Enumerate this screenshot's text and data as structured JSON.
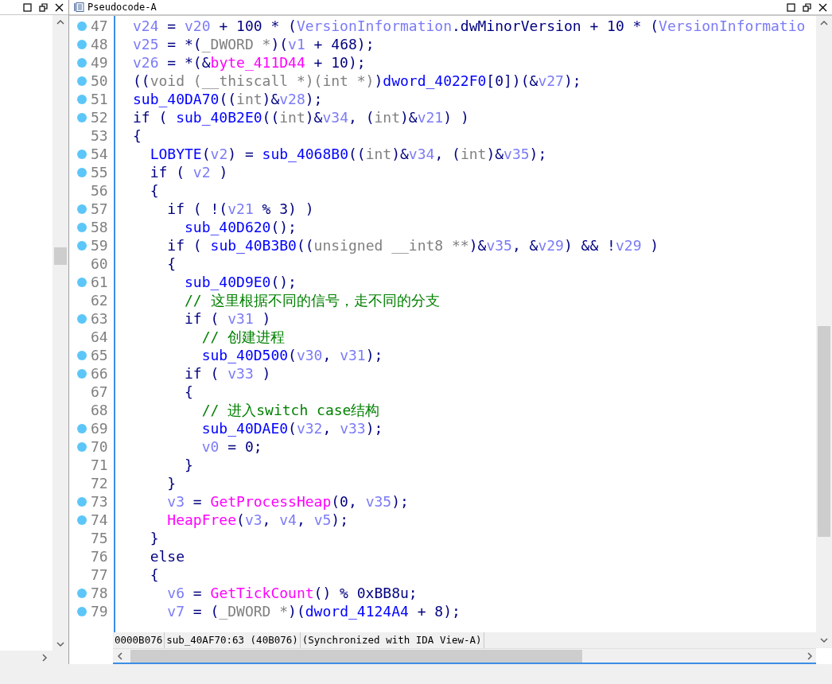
{
  "tab": {
    "title": "Pseudocode-A"
  },
  "code_lines": [
    {
      "number": "47",
      "dot": true,
      "tokens": [
        {
          "kind": "var",
          "text": "v24"
        },
        {
          "kind": "plain",
          "text": " = "
        },
        {
          "kind": "var",
          "text": "v20"
        },
        {
          "kind": "plain",
          "text": " + 100 * ("
        },
        {
          "kind": "var",
          "text": "VersionInformation"
        },
        {
          "kind": "plain",
          "text": ".dwMinorVersion + 10 * ("
        },
        {
          "kind": "var",
          "text": "VersionInformatio"
        }
      ]
    },
    {
      "number": "48",
      "dot": true,
      "tokens": [
        {
          "kind": "var",
          "text": "v25"
        },
        {
          "kind": "plain",
          "text": " = *("
        },
        {
          "kind": "type",
          "text": "_DWORD *"
        },
        {
          "kind": "plain",
          "text": ")("
        },
        {
          "kind": "var",
          "text": "v1"
        },
        {
          "kind": "plain",
          "text": " + 468);"
        }
      ]
    },
    {
      "number": "49",
      "dot": true,
      "tokens": [
        {
          "kind": "var",
          "text": "v26"
        },
        {
          "kind": "plain",
          "text": " = *(&"
        },
        {
          "kind": "import",
          "text": "byte_411D44"
        },
        {
          "kind": "plain",
          "text": " + 10);"
        }
      ]
    },
    {
      "number": "50",
      "dot": true,
      "tokens": [
        {
          "kind": "plain",
          "text": "(("
        },
        {
          "kind": "type",
          "text": "void (__thiscall *)(int *)"
        },
        {
          "kind": "plain",
          "text": ")"
        },
        {
          "kind": "func",
          "text": "dword_4022F0"
        },
        {
          "kind": "plain",
          "text": "[0])(&"
        },
        {
          "kind": "var",
          "text": "v27"
        },
        {
          "kind": "plain",
          "text": ");"
        }
      ]
    },
    {
      "number": "51",
      "dot": true,
      "tokens": [
        {
          "kind": "func",
          "text": "sub_40DA70"
        },
        {
          "kind": "plain",
          "text": "(("
        },
        {
          "kind": "type",
          "text": "int"
        },
        {
          "kind": "plain",
          "text": ")&"
        },
        {
          "kind": "var",
          "text": "v28"
        },
        {
          "kind": "plain",
          "text": ");"
        }
      ]
    },
    {
      "number": "52",
      "dot": true,
      "tokens": [
        {
          "kind": "plain",
          "text": "if ( "
        },
        {
          "kind": "func",
          "text": "sub_40B2E0"
        },
        {
          "kind": "plain",
          "text": "(("
        },
        {
          "kind": "type",
          "text": "int"
        },
        {
          "kind": "plain",
          "text": ")&"
        },
        {
          "kind": "var",
          "text": "v34"
        },
        {
          "kind": "plain",
          "text": ", ("
        },
        {
          "kind": "type",
          "text": "int"
        },
        {
          "kind": "plain",
          "text": ")&"
        },
        {
          "kind": "var",
          "text": "v21"
        },
        {
          "kind": "plain",
          "text": ") )"
        }
      ]
    },
    {
      "number": "53",
      "dot": false,
      "tokens": [
        {
          "kind": "plain",
          "text": "{"
        }
      ]
    },
    {
      "number": "54",
      "dot": true,
      "tokens": [
        {
          "kind": "func",
          "text": "  LOBYTE"
        },
        {
          "kind": "plain",
          "text": "("
        },
        {
          "kind": "var",
          "text": "v2"
        },
        {
          "kind": "plain",
          "text": ") = "
        },
        {
          "kind": "func",
          "text": "sub_4068B0"
        },
        {
          "kind": "plain",
          "text": "(("
        },
        {
          "kind": "type",
          "text": "int"
        },
        {
          "kind": "plain",
          "text": ")&"
        },
        {
          "kind": "var",
          "text": "v34"
        },
        {
          "kind": "plain",
          "text": ", ("
        },
        {
          "kind": "type",
          "text": "int"
        },
        {
          "kind": "plain",
          "text": ")&"
        },
        {
          "kind": "var",
          "text": "v35"
        },
        {
          "kind": "plain",
          "text": ");"
        }
      ]
    },
    {
      "number": "55",
      "dot": true,
      "tokens": [
        {
          "kind": "plain",
          "text": "  if ( "
        },
        {
          "kind": "var",
          "text": "v2"
        },
        {
          "kind": "plain",
          "text": " )"
        }
      ]
    },
    {
      "number": "56",
      "dot": false,
      "tokens": [
        {
          "kind": "plain",
          "text": "  {"
        }
      ]
    },
    {
      "number": "57",
      "dot": true,
      "tokens": [
        {
          "kind": "plain",
          "text": "    if ( !("
        },
        {
          "kind": "var",
          "text": "v21"
        },
        {
          "kind": "plain",
          "text": " % 3) )"
        }
      ]
    },
    {
      "number": "58",
      "dot": true,
      "tokens": [
        {
          "kind": "func",
          "text": "      sub_40D620"
        },
        {
          "kind": "plain",
          "text": "();"
        }
      ]
    },
    {
      "number": "59",
      "dot": true,
      "tokens": [
        {
          "kind": "plain",
          "text": "    if ( "
        },
        {
          "kind": "func",
          "text": "sub_40B3B0"
        },
        {
          "kind": "plain",
          "text": "(("
        },
        {
          "kind": "type",
          "text": "unsigned __int8 **"
        },
        {
          "kind": "plain",
          "text": ")&"
        },
        {
          "kind": "var",
          "text": "v35"
        },
        {
          "kind": "plain",
          "text": ", &"
        },
        {
          "kind": "var",
          "text": "v29"
        },
        {
          "kind": "plain",
          "text": ") && !"
        },
        {
          "kind": "var",
          "text": "v29"
        },
        {
          "kind": "plain",
          "text": " )"
        }
      ]
    },
    {
      "number": "60",
      "dot": false,
      "tokens": [
        {
          "kind": "plain",
          "text": "    {"
        }
      ]
    },
    {
      "number": "61",
      "dot": true,
      "tokens": [
        {
          "kind": "func",
          "text": "      sub_40D9E0"
        },
        {
          "kind": "plain",
          "text": "();"
        }
      ]
    },
    {
      "number": "62",
      "dot": false,
      "tokens": [
        {
          "kind": "comment",
          "text": "      // 这里根据不同的信号，走不同的分支"
        }
      ]
    },
    {
      "number": "63",
      "dot": true,
      "tokens": [
        {
          "kind": "plain",
          "text": "      if ( "
        },
        {
          "kind": "var",
          "text": "v31"
        },
        {
          "kind": "plain",
          "text": " )"
        }
      ]
    },
    {
      "number": "64",
      "dot": false,
      "tokens": [
        {
          "kind": "comment",
          "text": "        // 创建进程"
        }
      ]
    },
    {
      "number": "65",
      "dot": true,
      "tokens": [
        {
          "kind": "func",
          "text": "        sub_40D500"
        },
        {
          "kind": "plain",
          "text": "("
        },
        {
          "kind": "var",
          "text": "v30"
        },
        {
          "kind": "plain",
          "text": ", "
        },
        {
          "kind": "var",
          "text": "v31"
        },
        {
          "kind": "plain",
          "text": ");"
        }
      ]
    },
    {
      "number": "66",
      "dot": true,
      "tokens": [
        {
          "kind": "plain",
          "text": "      if ( "
        },
        {
          "kind": "var",
          "text": "v33"
        },
        {
          "kind": "plain",
          "text": " )"
        }
      ]
    },
    {
      "number": "67",
      "dot": false,
      "tokens": [
        {
          "kind": "plain",
          "text": "      {"
        }
      ]
    },
    {
      "number": "68",
      "dot": false,
      "tokens": [
        {
          "kind": "comment",
          "text": "        // 进入switch case结构"
        }
      ]
    },
    {
      "number": "69",
      "dot": true,
      "tokens": [
        {
          "kind": "func",
          "text": "        sub_40DAE0"
        },
        {
          "kind": "plain",
          "text": "("
        },
        {
          "kind": "var",
          "text": "v32"
        },
        {
          "kind": "plain",
          "text": ", "
        },
        {
          "kind": "var",
          "text": "v33"
        },
        {
          "kind": "plain",
          "text": ");"
        }
      ]
    },
    {
      "number": "70",
      "dot": true,
      "tokens": [
        {
          "kind": "var",
          "text": "        v0"
        },
        {
          "kind": "plain",
          "text": " = 0;"
        }
      ]
    },
    {
      "number": "71",
      "dot": false,
      "tokens": [
        {
          "kind": "plain",
          "text": "      }"
        }
      ]
    },
    {
      "number": "72",
      "dot": false,
      "tokens": [
        {
          "kind": "plain",
          "text": "    }"
        }
      ]
    },
    {
      "number": "73",
      "dot": true,
      "tokens": [
        {
          "kind": "var",
          "text": "    v3"
        },
        {
          "kind": "plain",
          "text": " = "
        },
        {
          "kind": "import",
          "text": "GetProcessHeap"
        },
        {
          "kind": "plain",
          "text": "(0, "
        },
        {
          "kind": "var",
          "text": "v35"
        },
        {
          "kind": "plain",
          "text": ");"
        }
      ]
    },
    {
      "number": "74",
      "dot": true,
      "tokens": [
        {
          "kind": "import",
          "text": "    HeapFree"
        },
        {
          "kind": "plain",
          "text": "("
        },
        {
          "kind": "var",
          "text": "v3"
        },
        {
          "kind": "plain",
          "text": ", "
        },
        {
          "kind": "var",
          "text": "v4"
        },
        {
          "kind": "plain",
          "text": ", "
        },
        {
          "kind": "var",
          "text": "v5"
        },
        {
          "kind": "plain",
          "text": ");"
        }
      ]
    },
    {
      "number": "75",
      "dot": false,
      "tokens": [
        {
          "kind": "plain",
          "text": "  }"
        }
      ]
    },
    {
      "number": "76",
      "dot": false,
      "tokens": [
        {
          "kind": "plain",
          "text": "  else"
        }
      ]
    },
    {
      "number": "77",
      "dot": false,
      "tokens": [
        {
          "kind": "plain",
          "text": "  {"
        }
      ]
    },
    {
      "number": "78",
      "dot": true,
      "tokens": [
        {
          "kind": "var",
          "text": "    v6"
        },
        {
          "kind": "plain",
          "text": " = "
        },
        {
          "kind": "import",
          "text": "GetTickCount"
        },
        {
          "kind": "plain",
          "text": "() % 0xBB8u;"
        }
      ]
    },
    {
      "number": "79",
      "dot": true,
      "tokens": [
        {
          "kind": "var",
          "text": "    v7"
        },
        {
          "kind": "plain",
          "text": " = ("
        },
        {
          "kind": "type",
          "text": "_DWORD *"
        },
        {
          "kind": "plain",
          "text": ")("
        },
        {
          "kind": "func",
          "text": "dword_4124A4"
        },
        {
          "kind": "plain",
          "text": " + 8);"
        }
      ]
    }
  ],
  "status_bar": [
    "0000B076",
    "sub_40AF70:63 (40B076)",
    "(Synchronized with IDA View-A)"
  ]
}
